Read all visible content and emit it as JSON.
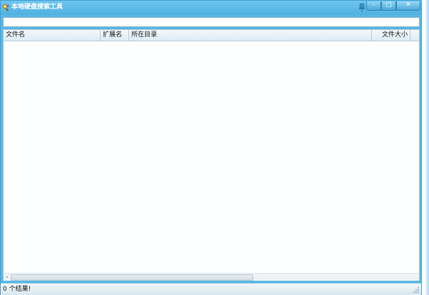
{
  "window": {
    "title": "本地硬盘搜索工具",
    "controls": {
      "minimize": "–",
      "maximize": "□",
      "close": "✕"
    }
  },
  "search": {
    "value": "",
    "placeholder": ""
  },
  "table": {
    "columns": [
      "文件名",
      "扩展名",
      "所在目录",
      "文件大小"
    ],
    "rows": []
  },
  "status": {
    "text": "0 个结果!"
  },
  "icons": {
    "app": "search-people-icon",
    "pin": "pin-icon"
  },
  "colors": {
    "titlebar": "#58b8e6",
    "header": "#dcebf4"
  }
}
